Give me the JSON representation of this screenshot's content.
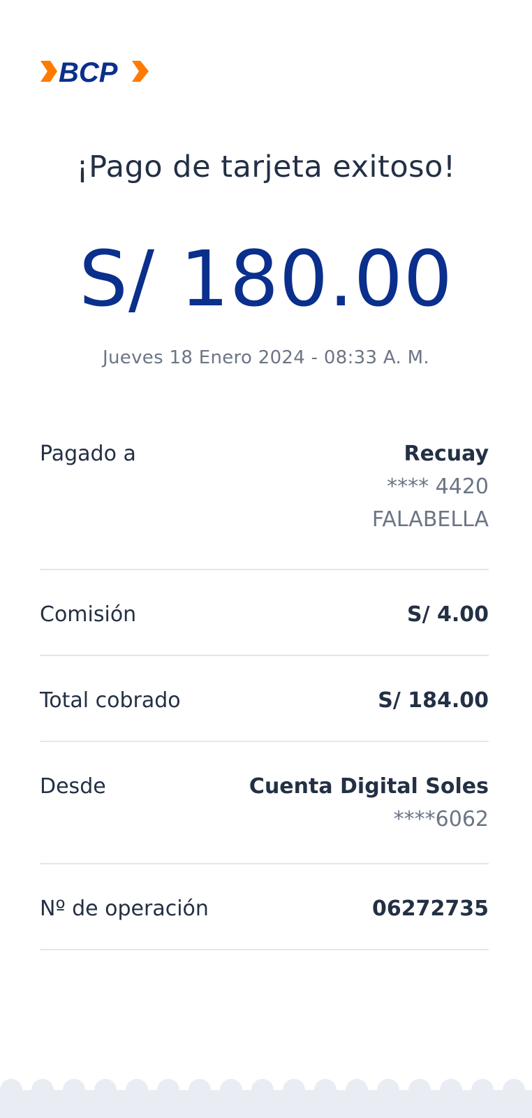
{
  "brand": {
    "logo_text": "BCP",
    "colors": {
      "blue": "#0a2f8c",
      "orange": "#ff7a00"
    }
  },
  "receipt": {
    "title": "¡Pago de tarjeta exitoso!",
    "amount": "S/ 180.00",
    "datetime": "Jueves 18 Enero 2024 - 08:33 A. M."
  },
  "details": [
    {
      "label": "Pagado a",
      "value": "Recuay",
      "sub1": "**** 4420",
      "sub2": "FALABELLA"
    },
    {
      "label": "Comisión",
      "value": "S/ 4.00"
    },
    {
      "label": "Total cobrado",
      "value": "S/ 184.00"
    },
    {
      "label": "Desde",
      "value": "Cuenta Digital Soles",
      "sub1": "****6062"
    },
    {
      "label": "Nº de operación",
      "value": "06272735"
    }
  ]
}
